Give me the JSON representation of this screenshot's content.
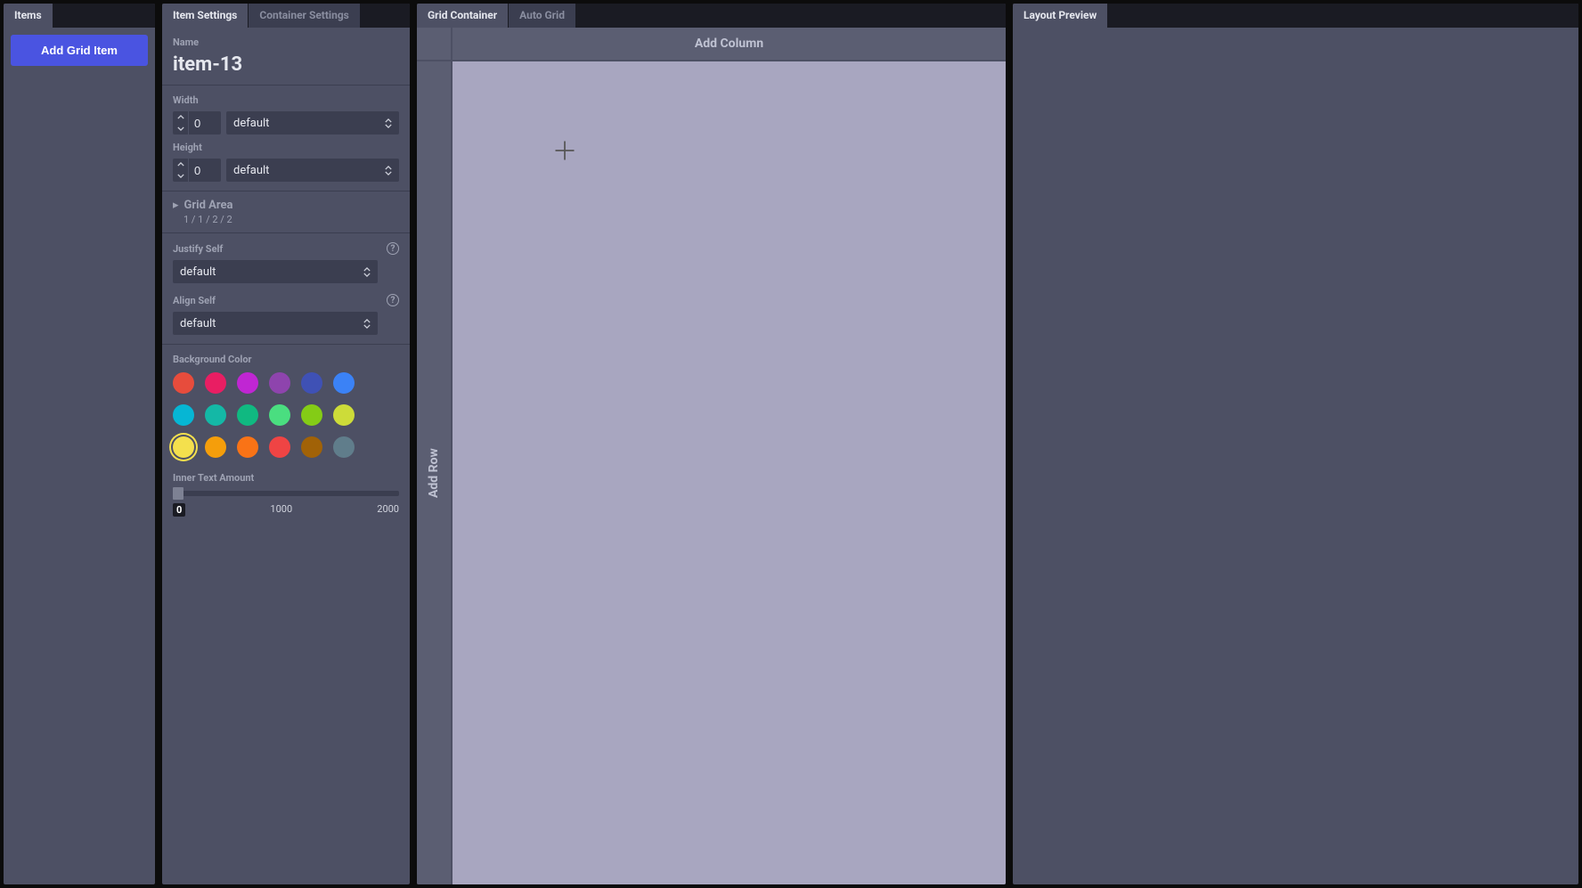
{
  "panels": {
    "items": {
      "tabs": [
        {
          "label": "Items",
          "active": true
        }
      ],
      "add_button": "Add Grid Item"
    },
    "settings": {
      "tabs": [
        {
          "label": "Item Settings",
          "active": true
        },
        {
          "label": "Container Settings",
          "active": false
        }
      ],
      "name": {
        "label": "Name",
        "value": "item-13"
      },
      "width": {
        "label": "Width",
        "value": "0",
        "unit": "default"
      },
      "height": {
        "label": "Height",
        "value": "0",
        "unit": "default"
      },
      "grid_area": {
        "title": "Grid Area",
        "value": "1 / 1 / 2 / 2"
      },
      "justify_self": {
        "label": "Justify Self",
        "value": "default"
      },
      "align_self": {
        "label": "Align Self",
        "value": "default"
      },
      "bg_color": {
        "label": "Background Color",
        "colors": [
          "#e74c3c",
          "#e91e63",
          "#c026d3",
          "#8e44ad",
          "#3f51b5",
          "#3b82f6",
          "#06b6d4",
          "#14b8a6",
          "#10b981",
          "#4ade80",
          "#84cc16",
          "#cddc39",
          "#f4e04d",
          "#f59e0b",
          "#f97316",
          "#ef4444",
          "#a16207",
          "#607d8b"
        ],
        "selected_index": 12
      },
      "inner_text": {
        "label": "Inner Text Amount",
        "value": "0",
        "mid": "1000",
        "max": "2000"
      }
    },
    "grid": {
      "tabs": [
        {
          "label": "Grid Container",
          "active": true
        },
        {
          "label": "Auto Grid",
          "active": false
        }
      ],
      "add_column": "Add Column",
      "add_row": "Add Row"
    },
    "preview": {
      "tabs": [
        {
          "label": "Layout Preview",
          "active": true
        }
      ]
    }
  }
}
